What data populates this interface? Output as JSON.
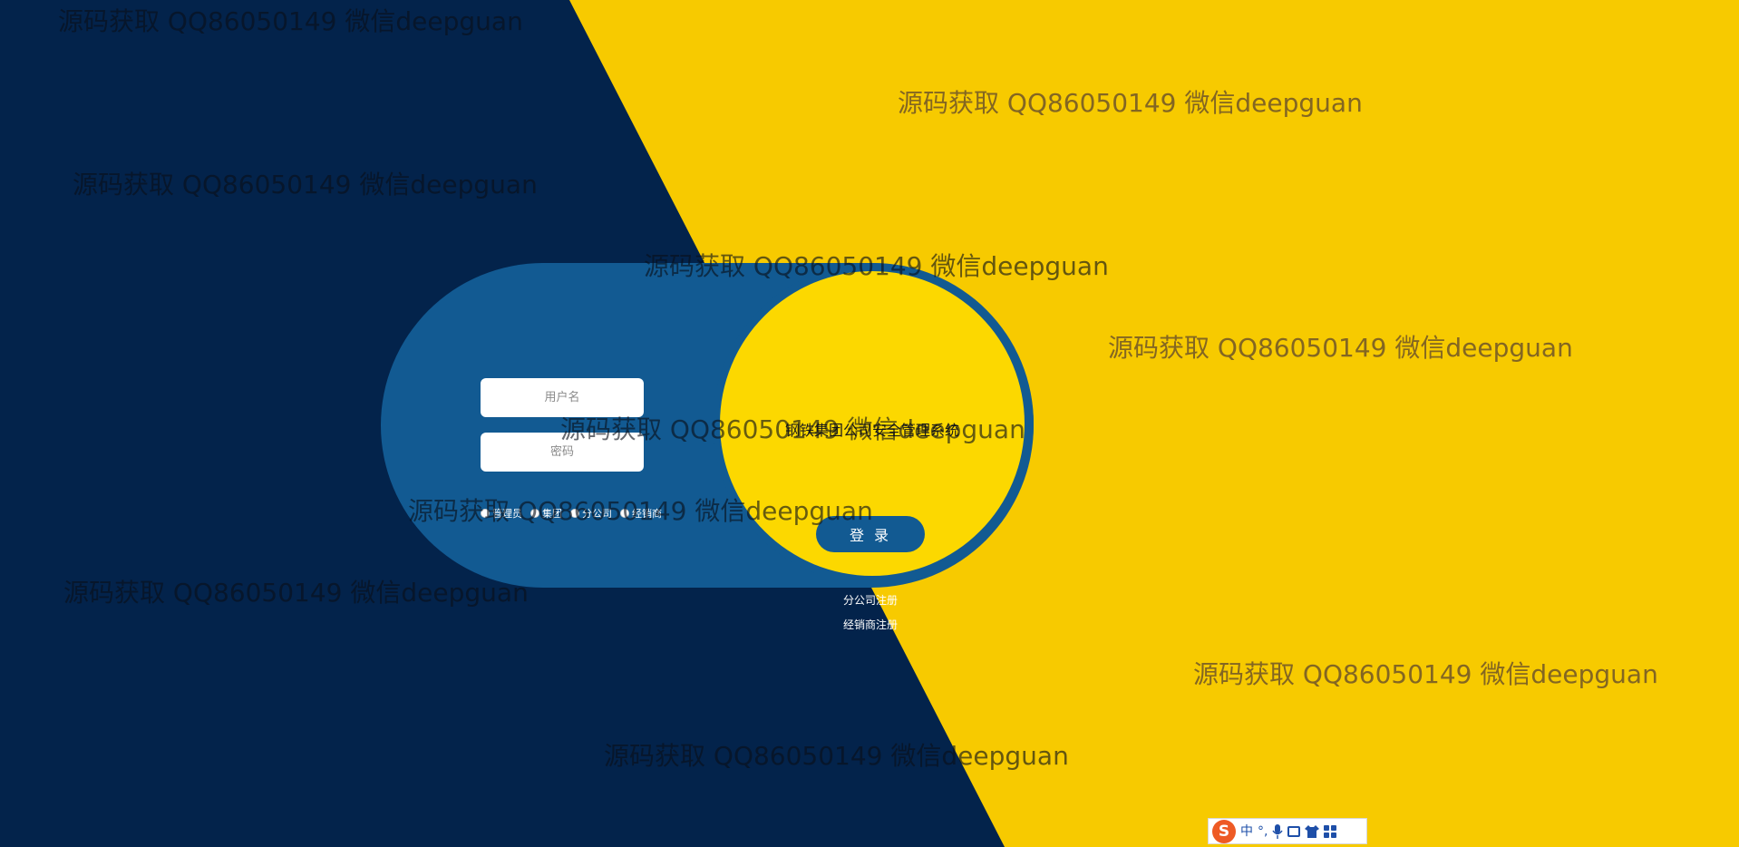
{
  "colors": {
    "navy_background": "#03234b",
    "yellow_background": "#f7ca00",
    "card_blue": "#125a92",
    "circle_yellow": "#fcd800",
    "ime_orange": "#ee5a24"
  },
  "login": {
    "username_placeholder": "用户名",
    "password_placeholder": "密码",
    "system_title": "钢铁集团公司安全管理系统",
    "roles": [
      "管理员",
      "集团",
      "分公司",
      "经销商"
    ],
    "login_button": "登 录",
    "branch_register": "分公司注册",
    "dealer_register": "经销商注册"
  },
  "watermark": {
    "text": "源码获取 QQ86050149 微信deepguan"
  },
  "ime": {
    "logo": "S",
    "mode": "中",
    "punct": "°,",
    "icons": [
      "mic-icon",
      "keyboard-icon",
      "shirt-icon",
      "grid-icon"
    ]
  }
}
